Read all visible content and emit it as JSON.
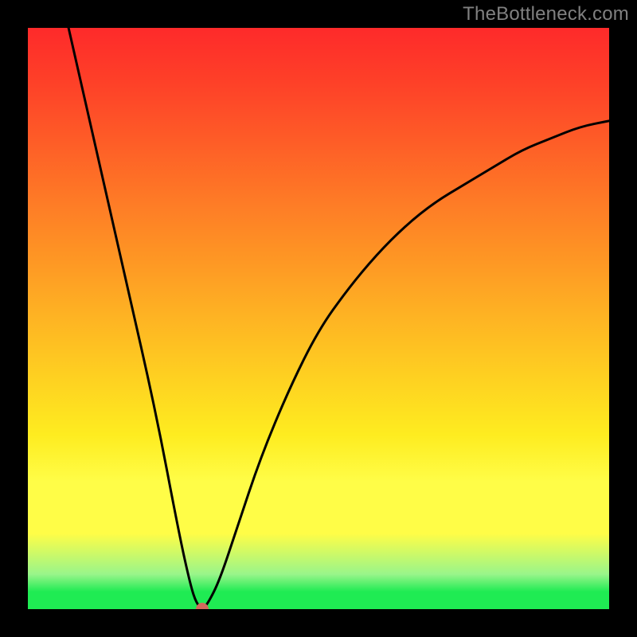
{
  "watermark": "TheBottleneck.com",
  "colors": {
    "curve": "#000000",
    "dot": "#d36a5c",
    "frame": "#000000"
  },
  "chart_data": {
    "type": "line",
    "title": "",
    "xlabel": "",
    "ylabel": "",
    "x_range": [
      0,
      100
    ],
    "y_range": [
      0,
      100
    ],
    "optimum_point": {
      "x": 30,
      "y": 0
    },
    "curve_points": [
      {
        "x": 7,
        "y": 100
      },
      {
        "x": 12,
        "y": 78
      },
      {
        "x": 17,
        "y": 56
      },
      {
        "x": 22,
        "y": 34
      },
      {
        "x": 26,
        "y": 13
      },
      {
        "x": 28,
        "y": 4
      },
      {
        "x": 29,
        "y": 1
      },
      {
        "x": 30,
        "y": 0
      },
      {
        "x": 31,
        "y": 1
      },
      {
        "x": 33,
        "y": 5
      },
      {
        "x": 36,
        "y": 14
      },
      {
        "x": 40,
        "y": 26
      },
      {
        "x": 45,
        "y": 38
      },
      {
        "x": 50,
        "y": 48
      },
      {
        "x": 55,
        "y": 55
      },
      {
        "x": 60,
        "y": 61
      },
      {
        "x": 65,
        "y": 66
      },
      {
        "x": 70,
        "y": 70
      },
      {
        "x": 75,
        "y": 73
      },
      {
        "x": 80,
        "y": 76
      },
      {
        "x": 85,
        "y": 79
      },
      {
        "x": 90,
        "y": 81
      },
      {
        "x": 95,
        "y": 83
      },
      {
        "x": 100,
        "y": 84
      }
    ]
  }
}
